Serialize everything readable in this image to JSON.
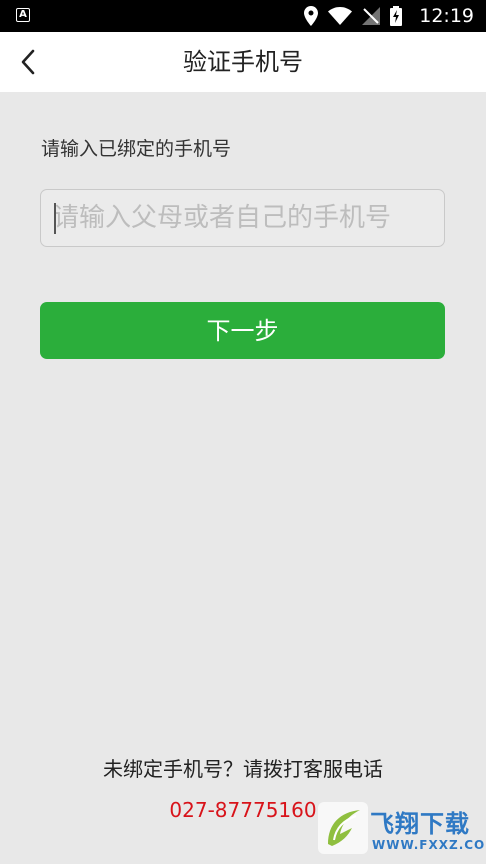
{
  "status_bar": {
    "left_icon_letter": "A",
    "time": "12:19",
    "icons": [
      "location-icon",
      "wifi-icon",
      "no-sim-icon",
      "battery-charging-icon"
    ]
  },
  "header": {
    "title": "验证手机号",
    "back_icon": "chevron-left-icon"
  },
  "form": {
    "label": "请输入已绑定的手机号",
    "phone_input": {
      "value": "",
      "placeholder": "请输入父母或者自己的手机号"
    },
    "next_label": "下一步"
  },
  "footer": {
    "hint": "未绑定手机号？请拨打客服电话",
    "phone": "027-87775160"
  },
  "watermark": {
    "text": "飞翔下载",
    "sub": "WWW.FXXZ.COM"
  },
  "colors": {
    "primary_green": "#2bae3b",
    "phone_red": "#d8131a",
    "background": "#e8e8e8",
    "watermark_blue": "#2f79c4"
  }
}
